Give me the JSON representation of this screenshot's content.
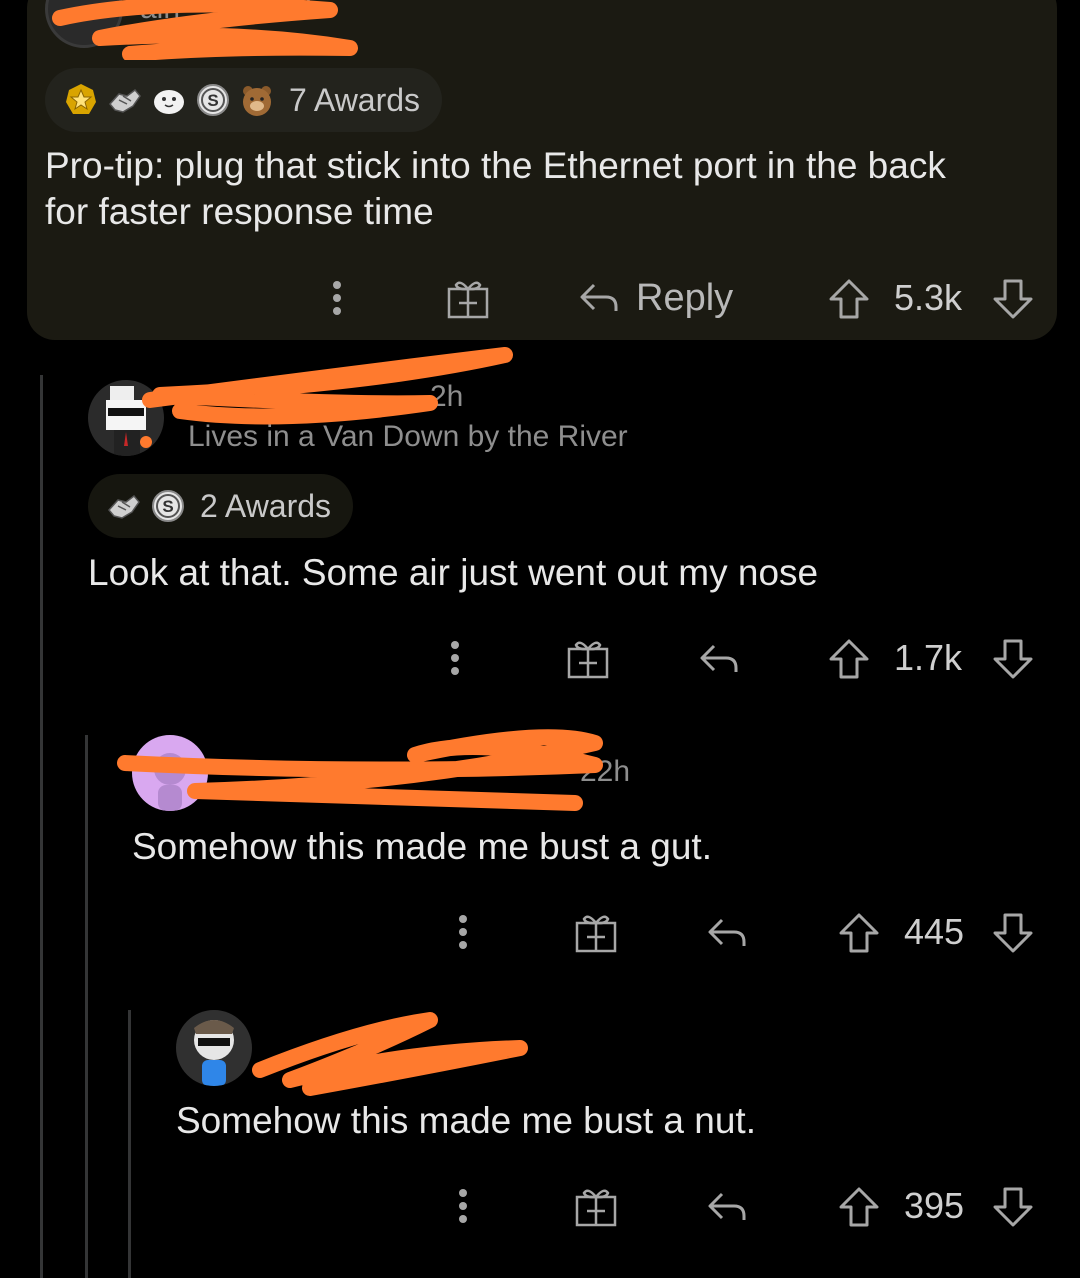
{
  "colors": {
    "background": "#000000",
    "highlight": "#1b1a12",
    "redaction": "#ff7a2e",
    "thread_line": "#343536"
  },
  "comments": [
    {
      "username_partial": "aih",
      "age_partial": "h",
      "awards_label": "7 Awards",
      "awards": [
        "gold-star-award-icon",
        "handshake-award-icon",
        "wholesome-seal-award-icon",
        "silver-coin-award-icon",
        "bear-award-icon"
      ],
      "body": "Pro-tip: plug that stick into the Ethernet port in the back",
      "body_line2": "for faster response time",
      "actions": {
        "reply_label": "Reply",
        "score": "5.3k"
      }
    },
    {
      "age_partial": "2h",
      "flair": "Lives in a Van Down by the River",
      "awards_label": "2 Awards",
      "awards": [
        "handshake-award-icon",
        "silver-coin-award-icon"
      ],
      "body": "Look at that. Some air just went out my nose",
      "actions": {
        "score": "1.7k"
      }
    },
    {
      "age_partial": "22h",
      "body": "Somehow this made me bust a gut.",
      "actions": {
        "score": "445"
      }
    },
    {
      "body": "Somehow this made me bust a nut.",
      "actions": {
        "score": "395"
      }
    }
  ]
}
